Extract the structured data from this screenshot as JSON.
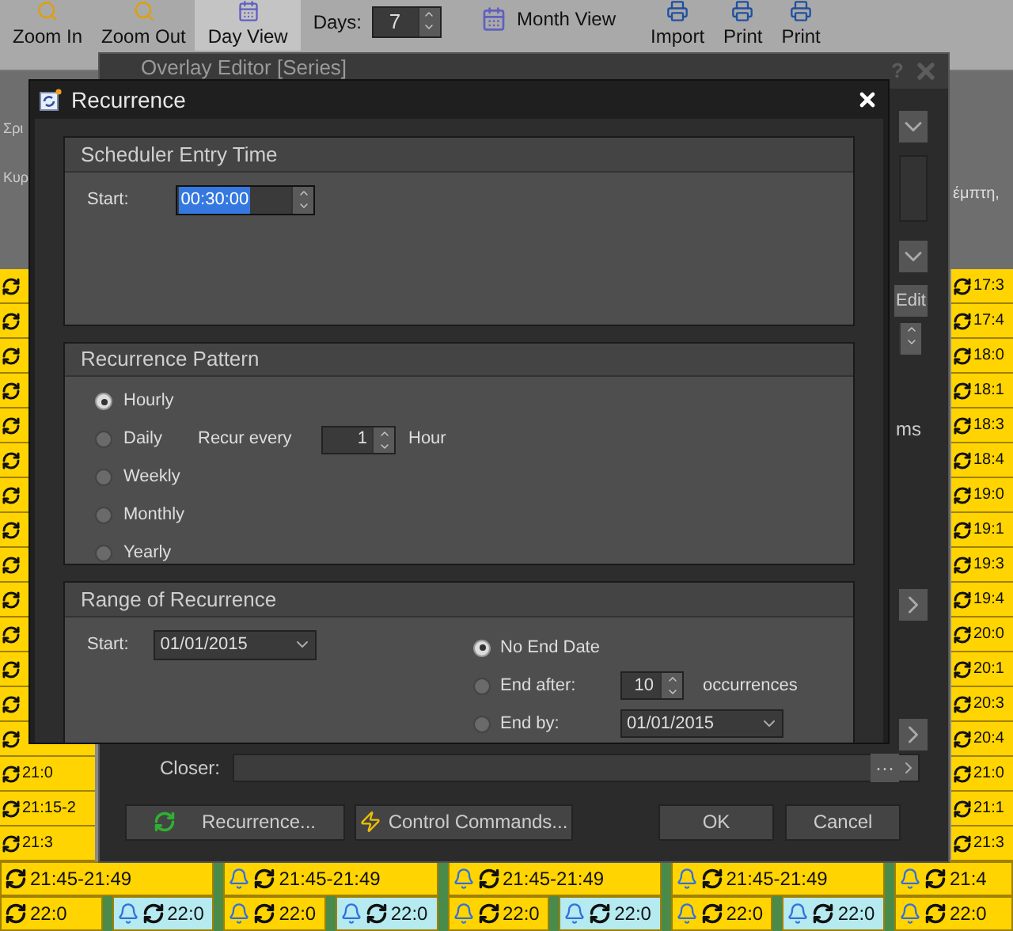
{
  "toolbar": [
    {
      "kind": "button",
      "label": "Zoom In"
    },
    {
      "kind": "button",
      "label": "Zoom Out"
    },
    {
      "kind": "toggle",
      "label": "Day View",
      "selected": true
    },
    {
      "kind": "spinner",
      "label": "Days:",
      "value": "7"
    },
    {
      "kind": "link",
      "label": "Month View"
    },
    {
      "kind": "button",
      "label": "Import"
    },
    {
      "kind": "button",
      "label": "Print"
    },
    {
      "kind": "button",
      "label": "Print"
    }
  ],
  "scheduler": {
    "left_labels": [
      "Σρι",
      "Κυρ"
    ],
    "right_label": "έμπτη,",
    "left_column": [
      "21:0",
      "21:15-2",
      "21:3"
    ],
    "right_column": [
      "17:3",
      "17:4",
      "18:0",
      "18:1",
      "18:3",
      "18:4",
      "19:0",
      "19:1",
      "19:3",
      "19:4",
      "20:0",
      "20:1",
      "20:3",
      "20:4",
      "21:0",
      "21:1",
      "21:3"
    ],
    "bottom_rows": [
      {
        "cells": [
          {
            "text": "21:45-21:49",
            "color": "#ffd400",
            "alarm": false
          },
          {
            "text": "21:45-21:49",
            "color": "#ffd400",
            "alarm": true
          },
          {
            "text": "21:45-21:49",
            "color": "#ffd400",
            "alarm": true
          },
          {
            "text": "21:45-21:49",
            "color": "#ffd400",
            "alarm": true
          },
          {
            "text": "21:4",
            "color": "#ffd400",
            "alarm": true
          }
        ]
      },
      {
        "cells": [
          {
            "text": "22:0",
            "color": "#ffd400",
            "alarm": false
          },
          {
            "text": "22:0",
            "color": "#b4eaf0",
            "alarm": true
          },
          {
            "text": "22:0",
            "color": "#ffd400",
            "alarm": true
          },
          {
            "text": "22:0",
            "color": "#b4eaf0",
            "alarm": true
          },
          {
            "text": "22:0",
            "color": "#ffd400",
            "alarm": true
          },
          {
            "text": "22:0",
            "color": "#b4eaf0",
            "alarm": true
          },
          {
            "text": "22:0",
            "color": "#ffd400",
            "alarm": true
          },
          {
            "text": "22:0",
            "color": "#b4eaf0",
            "alarm": true
          },
          {
            "text": "22:0",
            "color": "#ffd400",
            "alarm": true
          }
        ]
      }
    ]
  },
  "overlay_editor": {
    "title": "Overlay Editor [Series]",
    "help": "?",
    "edit_button": "Edit",
    "unit": "ms",
    "closer_label": "Closer:",
    "closer_more": "···",
    "buttons": [
      {
        "kind": "recurrence",
        "label": "Recurrence..."
      },
      {
        "kind": "commands",
        "label": "Control Commands..."
      },
      {
        "kind": "plain",
        "label": "OK"
      },
      {
        "kind": "plain",
        "label": "Cancel"
      }
    ]
  },
  "recurrence": {
    "title": "Recurrence",
    "entry_time": {
      "title": "Scheduler Entry Time",
      "start_label": "Start:",
      "value": "00:30:00"
    },
    "pattern": {
      "title": "Recurrence Pattern",
      "options": [
        {
          "label": "Hourly",
          "selected": true
        },
        {
          "label": "Daily",
          "selected": false
        },
        {
          "label": "Weekly",
          "selected": false
        },
        {
          "label": "Monthly",
          "selected": false
        },
        {
          "label": "Yearly",
          "selected": false
        }
      ],
      "recur_label": "Recur every",
      "recur_value": "1",
      "unit": "Hour"
    },
    "range": {
      "title": "Range of Recurrence",
      "start_label": "Start:",
      "start_value": "01/01/2015",
      "options": [
        {
          "kind": "none",
          "label": "No End Date",
          "selected": true
        },
        {
          "kind": "after",
          "label": "End after:",
          "value": "10",
          "suffix": "occurrences",
          "selected": false
        },
        {
          "kind": "by",
          "label": "End by:",
          "value": "01/01/2015",
          "selected": false
        }
      ]
    }
  }
}
